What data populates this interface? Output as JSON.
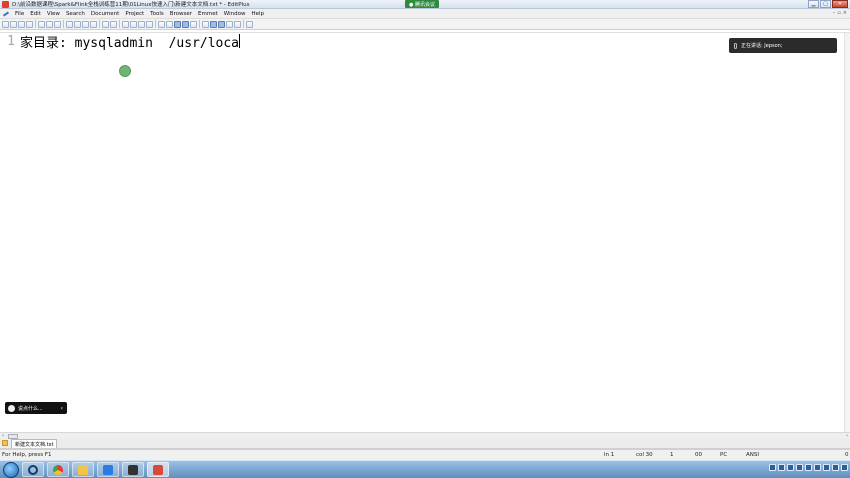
{
  "window": {
    "title": "D:\\前沿数据课程\\Spark&Flink全栈训练营11期\\01Linux快速入门\\新建文本文档.txt * - EditPlus",
    "meeting_badge": "● 腾讯会议"
  },
  "menu": {
    "items": [
      "File",
      "Edit",
      "View",
      "Search",
      "Document",
      "Project",
      "Tools",
      "Browser",
      "Emmet",
      "Window",
      "Help"
    ]
  },
  "editor": {
    "line_number": "1",
    "line_text": "家目录: mysqladmin  /usr/loca"
  },
  "overlay": {
    "speaking_label": "正在讲话: Jepson;",
    "chat_placeholder": "说点什么...",
    "chat_chevron": "‹"
  },
  "tabs": {
    "file_tab": "新建文本文档.txt"
  },
  "status": {
    "help": "For Help, press F1",
    "ln": "ln 1",
    "col": "col 30",
    "sel": "1",
    "ovr": "00",
    "mode": "PC",
    "encoding": "ANSI",
    "end": "0"
  },
  "colors": {
    "close_button": "#c9452f",
    "speaking_bg": "#2b2b2b",
    "meeting_green": "#2e8b3d",
    "taskbar": "#5f8fbf"
  }
}
